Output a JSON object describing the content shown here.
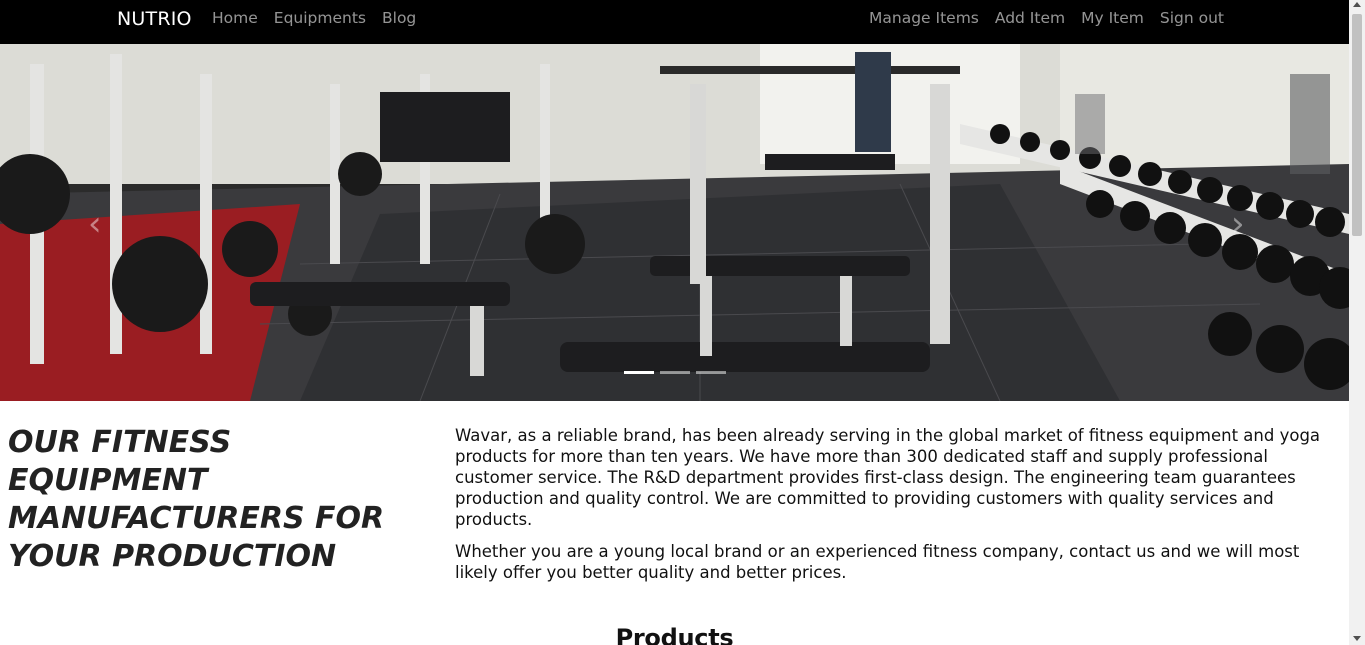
{
  "navbar": {
    "brand": "NUTRIO",
    "left_links": [
      "Home",
      "Equipments",
      "Blog"
    ],
    "right_links": [
      "Manage Items",
      "Add Item",
      "My Item",
      "Sign out"
    ]
  },
  "carousel": {
    "slide_count": 3,
    "active_index": 0,
    "prev_icon": "chevron-left-icon",
    "next_icon": "chevron-right-icon"
  },
  "intro": {
    "headline_lines": [
      "OUR FITNESS EQUIPMENT",
      "MANUFACTURERS FOR",
      "YOUR PRODUCTION"
    ],
    "paragraph_1": "Wavar, as a reliable brand, has been already serving in the global market of fitness equipment and yoga products for more than ten years. We have more than 300 dedicated staff and supply professional customer service. The R&D department provides first-class design. The engineering team guarantees production and quality control. We are committed to providing customers with quality services and products.",
    "paragraph_2": "Whether you are a young local brand or an experienced fitness company, contact us and we will most likely offer you better quality and better prices."
  },
  "products": {
    "title": "Products"
  }
}
